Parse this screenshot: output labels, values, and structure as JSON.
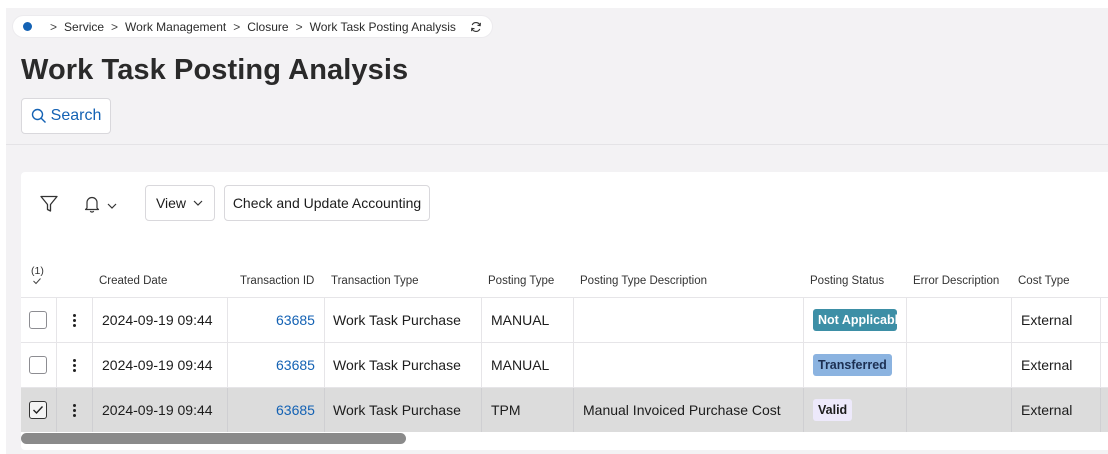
{
  "breadcrumb": {
    "items": [
      "Service",
      "Work Management",
      "Closure",
      "Work Task Posting Analysis"
    ]
  },
  "page": {
    "title": "Work Task Posting Analysis"
  },
  "search": {
    "label": "Search"
  },
  "toolbar": {
    "view_label": "View",
    "check_update_label": "Check and Update Accounting"
  },
  "table": {
    "selected_count": "(1)",
    "columns": {
      "created_date": "Created Date",
      "transaction_id": "Transaction ID",
      "transaction_type": "Transaction Type",
      "posting_type": "Posting Type",
      "posting_type_description": "Posting Type Description",
      "posting_status": "Posting Status",
      "error_description": "Error Description",
      "cost_type": "Cost Type"
    },
    "rows": [
      {
        "selected": false,
        "created_date": "2024-09-19 09:44",
        "transaction_id": "63685",
        "transaction_type": "Work Task Purchase",
        "posting_type": "MANUAL",
        "posting_type_description": "",
        "posting_status": "Not Applicable",
        "error_description": "",
        "cost_type": "External"
      },
      {
        "selected": false,
        "created_date": "2024-09-19 09:44",
        "transaction_id": "63685",
        "transaction_type": "Work Task Purchase",
        "posting_type": "MANUAL",
        "posting_type_description": "",
        "posting_status": "Transferred",
        "error_description": "",
        "cost_type": "External"
      },
      {
        "selected": true,
        "created_date": "2024-09-19 09:44",
        "transaction_id": "63685",
        "transaction_type": "Work Task Purchase",
        "posting_type": "TPM",
        "posting_type_description": "Manual Invoiced Purchase Cost",
        "posting_status": "Valid",
        "error_description": "",
        "cost_type": "External"
      }
    ]
  },
  "colors": {
    "accent": "#1462b4",
    "status_not_applicable": "#3d8fa6",
    "status_transferred": "#8bb3e0",
    "status_valid": "#ede9fb"
  }
}
